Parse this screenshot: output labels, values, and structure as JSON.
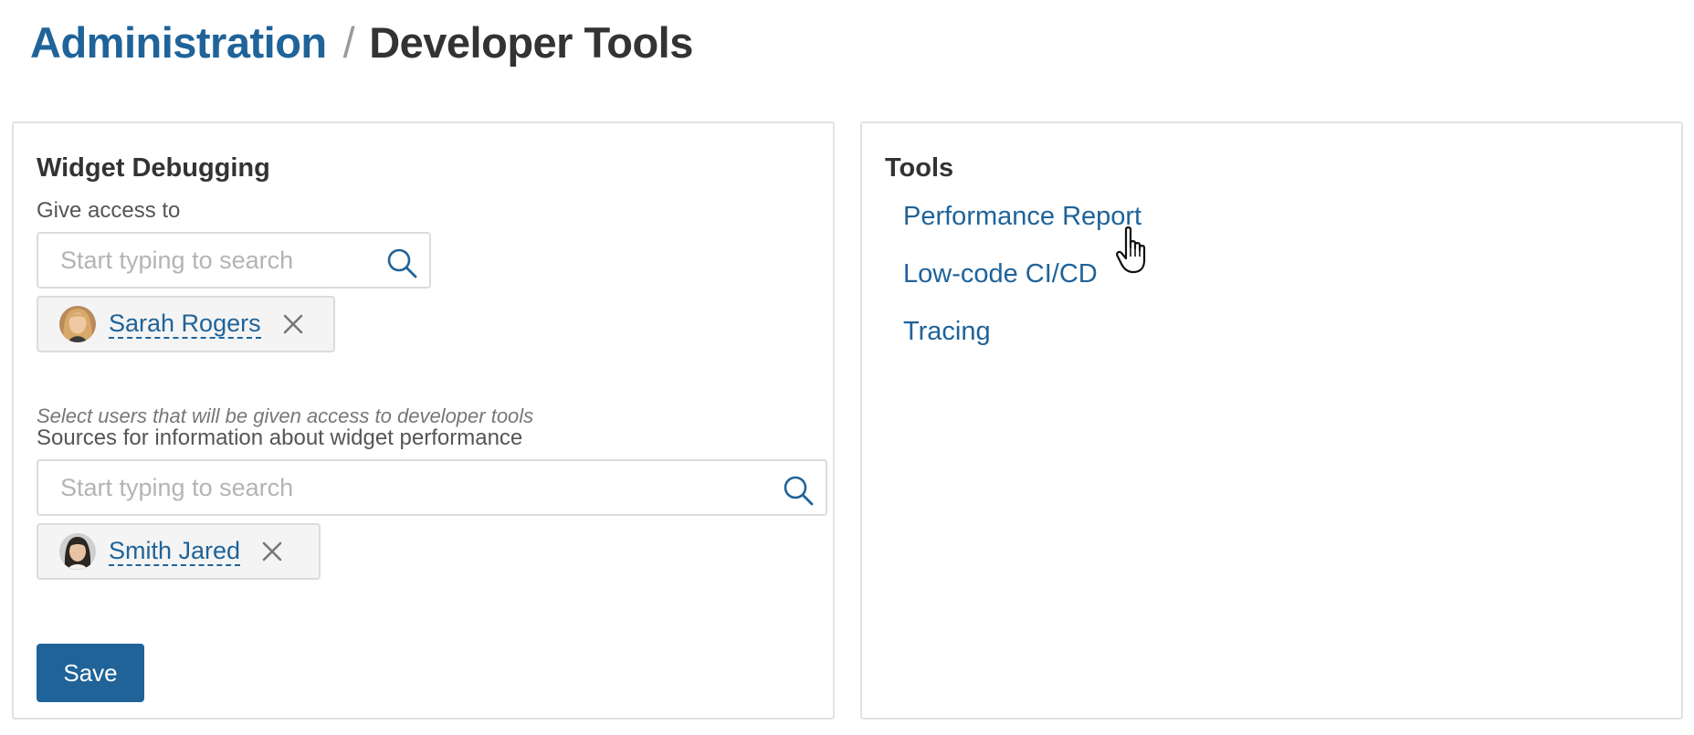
{
  "header": {
    "breadcrumb_parent": "Administration",
    "separator": "/",
    "title": "Developer Tools"
  },
  "widget_debugging": {
    "title": "Widget Debugging",
    "give_access": {
      "label": "Give access to",
      "placeholder": "Start typing to search",
      "selected_users": [
        {
          "name": "Sarah Rogers",
          "avatar": "avatar-photo"
        }
      ],
      "hint": "Select users that will be given access to developer tools"
    },
    "sources": {
      "label": "Sources for information about widget performance",
      "placeholder": "Start typing to search",
      "selected_users": [
        {
          "name": "Smith Jared",
          "avatar": "avatar-photo"
        }
      ]
    },
    "save_label": "Save"
  },
  "tools": {
    "title": "Tools",
    "items": [
      {
        "label": "Performance Report"
      },
      {
        "label": "Low-code CI/CD"
      },
      {
        "label": "Tracing"
      }
    ]
  },
  "icons": {
    "search": "search-icon",
    "remove": "close-icon",
    "cursor": "hand-pointer-icon"
  },
  "colors": {
    "accent": "#1f6399",
    "text": "#333333",
    "border": "#e2e2e2",
    "chip_background": "#f4f4f4",
    "placeholder": "#b4b4b4"
  }
}
